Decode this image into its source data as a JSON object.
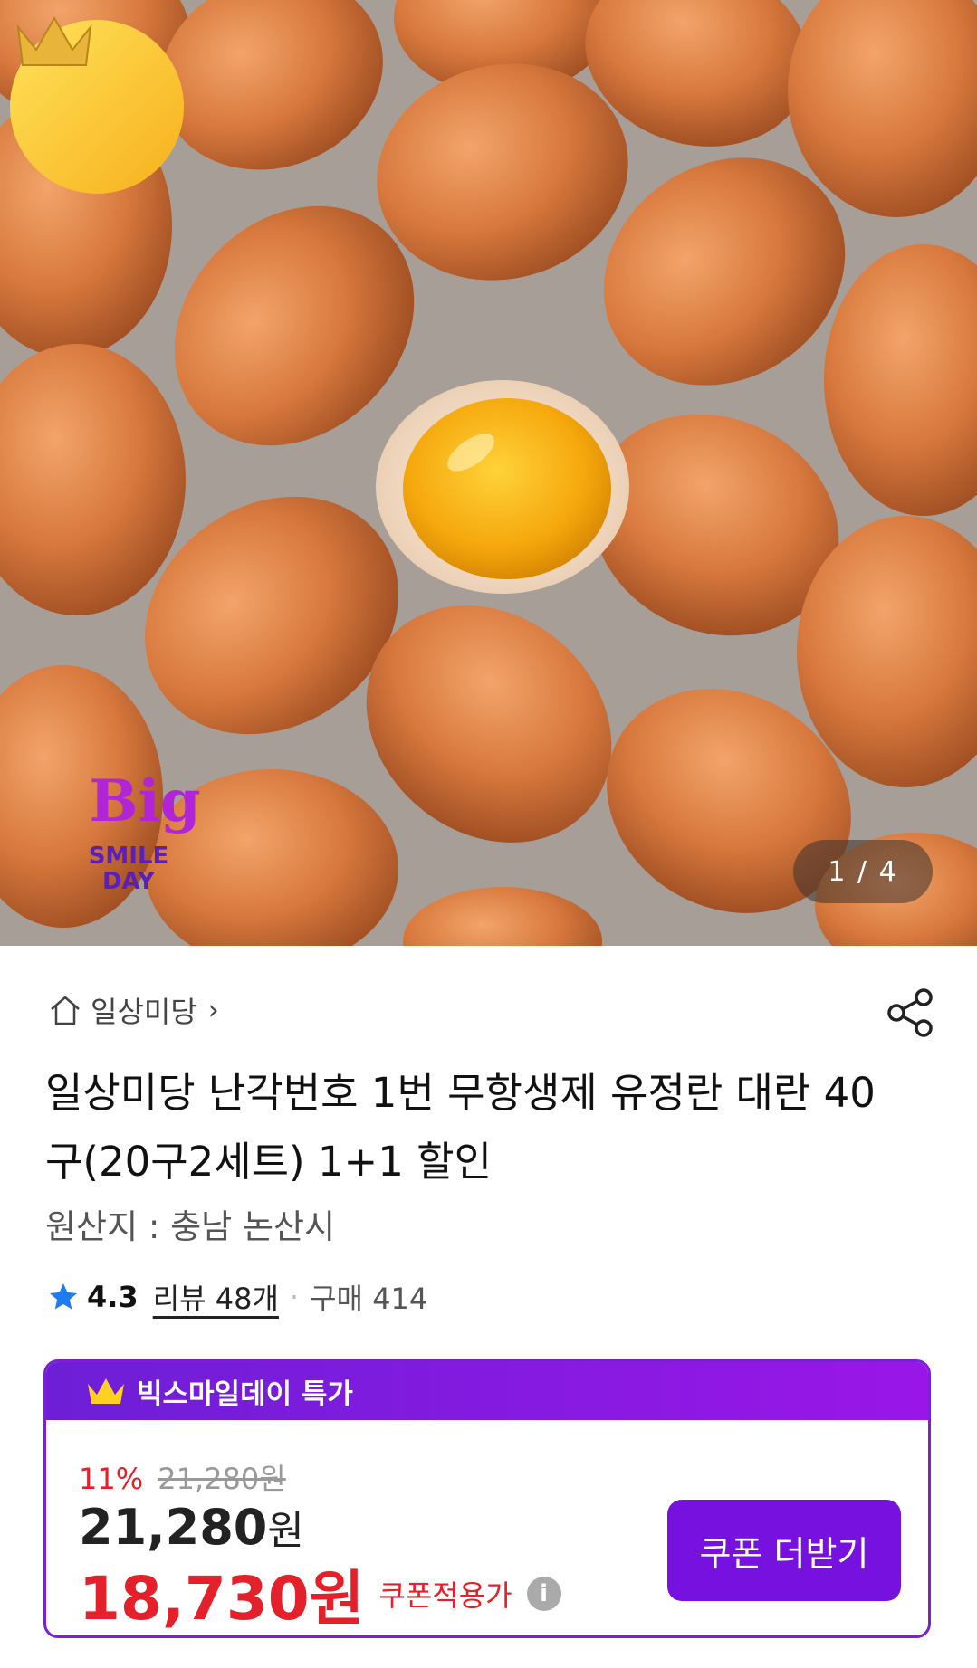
{
  "gallery": {
    "counter": "1 / 4",
    "badge": {
      "line1": "Big",
      "line2": "SMILE",
      "line3": "DAY"
    }
  },
  "store": {
    "name": "일상미당",
    "chevron": "›"
  },
  "product": {
    "title": "일상미당 난각번호 1번 무항생제 유정란 대란 40구(20구2세트) 1+1 할인",
    "origin": "원산지 : 충남 논산시"
  },
  "rating": {
    "score": "4.3",
    "reviews": "리뷰 48개",
    "separator": "·",
    "purchases": "구매 414"
  },
  "deal": {
    "header": "빅스마일데이 특가",
    "discount_pct": "11%",
    "original_price": "21,280원",
    "price_number": "21,280",
    "price_unit": "원",
    "coupon_price": "18,730원",
    "coupon_caption": "쿠폰적용가",
    "info_icon": "i",
    "coupon_button": "쿠폰 더받기"
  },
  "colors": {
    "accent": "#7611e0",
    "sale": "#e4202a",
    "star": "#1e7bf2"
  },
  "icons": [
    "home-icon",
    "share-icon",
    "star-icon",
    "crown-icon",
    "info-icon"
  ]
}
